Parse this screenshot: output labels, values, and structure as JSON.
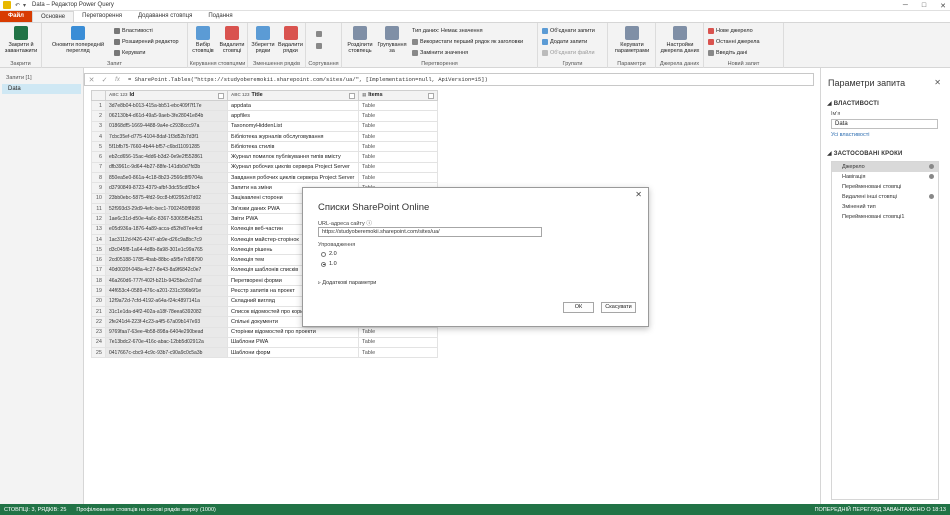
{
  "window": {
    "title": "Data – Редактор Power Query",
    "minimize": "─",
    "maximize": "□",
    "close": "✕"
  },
  "quick_access": {
    "undo": "↶",
    "dropdown": "▾"
  },
  "tabs": [
    {
      "label": "Файл"
    },
    {
      "label": "Основне"
    },
    {
      "label": "Перетворення"
    },
    {
      "label": "Додавання стовпця"
    },
    {
      "label": "Подання"
    }
  ],
  "ribbon": {
    "groups": [
      {
        "label": "Закрити"
      },
      {
        "label": "Запит"
      },
      {
        "label": "Керування стовпцями"
      },
      {
        "label": "Зменшення рядків"
      },
      {
        "label": "Сортування"
      },
      {
        "label": "Перетворення"
      },
      {
        "label": "Групати"
      },
      {
        "label": "Параметри"
      },
      {
        "label": "Джерела даних"
      },
      {
        "label": "Новий запит"
      }
    ],
    "close_apply": "Закрити й завантажити",
    "refresh": "Оновити попередній перегляд",
    "properties": "Властивості",
    "adv_editor": "Розширений редактор",
    "manage": "Керувати",
    "choose_cols": "Вибір стовпців",
    "remove_cols": "Видалити стовпці",
    "keep_rows": "Зберегти рядки",
    "remove_rows": "Видалити рядки",
    "split_col": "Розділити стовпець",
    "group_by": "Групування за",
    "data_type": "Тип даних: Немає значення",
    "first_row_header": "Використати перший рядок як заголовки",
    "replace_values": "Замінити значення",
    "merge_queries": "Об'єднати запити",
    "append_queries": "Додати запити",
    "combine_files": "Об'єднати файли",
    "manage_params": "Керувати параметрами",
    "ds_settings": "Настройки джерела даних",
    "new_source": "Нове джерело",
    "recent_sources": "Останні джерела",
    "enter_data": "Введіть дані"
  },
  "formula": {
    "cancel": "✕",
    "accept": "✓",
    "fx": "fx",
    "text": "= SharePoint.Tables(\"https://studyoberemokii.sharepoint.com/sites/ua/\", [Implementation=null, ApiVersion=15])"
  },
  "queries": {
    "header": "Запити [1]",
    "items": [
      {
        "label": "Data"
      }
    ]
  },
  "table": {
    "headers": [
      {
        "type": "ABC 123",
        "label": "Id"
      },
      {
        "type": "ABC 123",
        "label": "Title"
      },
      {
        "type": "",
        "label": "Items"
      }
    ],
    "rows": [
      {
        "n": "1",
        "id": "3d7e8b04-b013-415a-bb51-ebc409f7f17e",
        "title": "appdata",
        "items": "Table"
      },
      {
        "n": "2",
        "id": "062130b4-d61d-49a5-9aeb-3fe28041e84b",
        "title": "appfiles",
        "items": "Table"
      },
      {
        "n": "3",
        "id": "01868df5-1669-4488-9a4e-c2938ccc97a",
        "title": "TaxonomyHiddenList",
        "items": "Table"
      },
      {
        "n": "4",
        "id": "7cbc35ef-d775-4104-8daf-1f3d52b7d3f1",
        "title": "Бібліотека журналів обслуговування",
        "items": "Table"
      },
      {
        "n": "5",
        "id": "5f1bfb75-7660-4b44-bf57-c6bd11091285",
        "title": "Бібліотека стилів",
        "items": "Table"
      },
      {
        "n": "6",
        "id": "eb2cd656-15ac-4dd6-b3d2-0e9e2f552861",
        "title": "Журнал помилок публікування типів вмісту",
        "items": "Table"
      },
      {
        "n": "7",
        "id": "dfb3961c-9d64-4b27-88fe-141db0d7fd3b",
        "title": "Журнал робочих циклів сервера Project Server",
        "items": "Table"
      },
      {
        "n": "8",
        "id": "850ea5e0-861a-4c18-8b23-2566c8f9704a",
        "title": "Завдання робочих циклів сервера Project Server",
        "items": "Table"
      },
      {
        "n": "9",
        "id": "d3790849-8723-4379-afbf-3dc55cdf2bc4",
        "title": "Запити на зміни",
        "items": "Table"
      },
      {
        "n": "10",
        "id": "23bb0ebc-5875-4fd2-9cc8-bf02952d7d02",
        "title": "Зацікавлені сторони",
        "items": "Table"
      },
      {
        "n": "11",
        "id": "52f993d3-29d9-4efc-bec1-7002450f8998",
        "title": "Зв'язки даних PWA",
        "items": "Table"
      },
      {
        "n": "12",
        "id": "1ae6c31d-d50e-4a6c-8367-53065f54b251",
        "title": "Звіти PWA",
        "items": "Table"
      },
      {
        "n": "13",
        "id": "e05d936a-1876-4a89-acca-d52fe87ee4cd",
        "title": "Колекція веб-частин",
        "items": "Table"
      },
      {
        "n": "14",
        "id": "1ac3112d-f426-4247-ab9e-d26c9a8bc7c9",
        "title": "Колекція майстер-сторінок",
        "items": "Table"
      },
      {
        "n": "15",
        "id": "d3c045f8-1a64-4d8b-8a98-301e1c99a765",
        "title": "Колекція рішень",
        "items": "Table"
      },
      {
        "n": "16",
        "id": "2cd05188-1785-4bab-88bc-a5f5e7d08790",
        "title": "Колекція тем",
        "items": "Table"
      },
      {
        "n": "17",
        "id": "40d0020f-048a-4c27-8e43-8a9f6842c0e7",
        "title": "Колекція шаблонів списків",
        "items": "Table"
      },
      {
        "n": "18",
        "id": "46a260d6-777f-402f-b21b-9425be2c07ad",
        "title": "Перетворені форми",
        "items": "Table"
      },
      {
        "n": "19",
        "id": "44f653c4-0589-476c-a201-231c396b6f1e",
        "title": "Реєстр запитів на проект",
        "items": "Table"
      },
      {
        "n": "20",
        "id": "12f9a72d-7cfd-4192-a64a-f24c4897141a",
        "title": "Складний вигляд",
        "items": "Table"
      },
      {
        "n": "21",
        "id": "31c1e1da-d4f2-402a-a18f-78eea6392082",
        "title": "Список відомостей про користувач",
        "items": "Table"
      },
      {
        "n": "22",
        "id": "2fe241d4-223f-4c23-a4f5-67a09b147e93",
        "title": "Спільні документи",
        "items": "Table"
      },
      {
        "n": "23",
        "id": "9769faa7-63ee-4b58-898a-6404e290bead",
        "title": "Сторінки відомостей про проекти",
        "items": "Table"
      },
      {
        "n": "24",
        "id": "7e13bdc2-670e-416c-abac-12bb5d02912a",
        "title": "Шаблони PWA",
        "items": "Table"
      },
      {
        "n": "25",
        "id": "0417667c-cbc9-4c9c-93b7-c90a9c0c5a3b",
        "title": "Шаблони форм",
        "items": "Table"
      }
    ]
  },
  "settings": {
    "title": "Параметри запита",
    "close": "✕",
    "props_header": "ВЛАСТИВОСТІ",
    "name_label": "Ім'я",
    "name_value": "Data",
    "all_props": "Усі властивості",
    "steps_header": "ЗАСТОСОВАНІ КРОКИ",
    "steps": [
      {
        "label": "Джерело",
        "gear": true,
        "selected": true
      },
      {
        "label": "Навігація",
        "gear": true
      },
      {
        "label": "Перейменовані стовпці",
        "gear": false
      },
      {
        "label": "Видалені інші стовпці",
        "gear": true
      },
      {
        "label": "Змінений тип",
        "gear": false
      },
      {
        "label": "Перейменовані стовпці1",
        "gear": false
      }
    ]
  },
  "dialog": {
    "title": "Списки SharePoint Online",
    "url_label": "URL-адреса сайту",
    "url_value": "https://studyoberemokii.sharepoint.com/sites/ua/",
    "impl_label": "Упровадження",
    "opt1": "2.0",
    "opt2": "1.0",
    "advanced": "Додаткові параметри",
    "ok": "ОК",
    "cancel": "Скасувати",
    "close": "✕"
  },
  "status": {
    "left": "СТОВПЦІ: 3, РЯДКІВ: 25",
    "profile": "Профілювання стовпців на основі рядків зверху (1000)",
    "right": "ПОПЕРЕДНІЙ ПЕРЕГЛЯД ЗАВАНТАЖЕНО О 18:13"
  }
}
